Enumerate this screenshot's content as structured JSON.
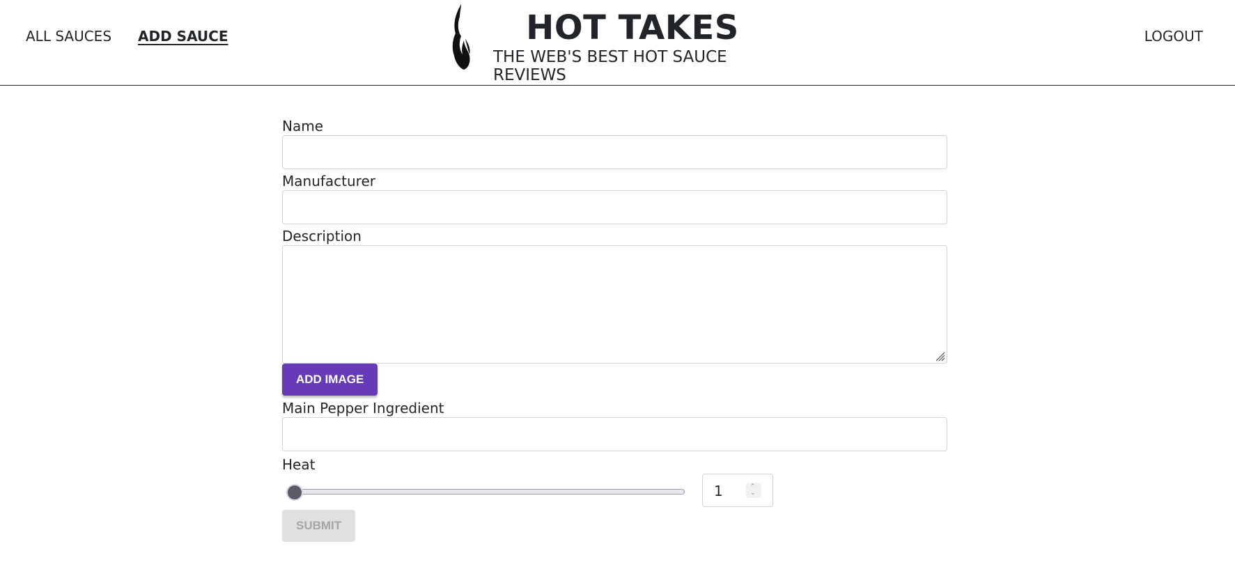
{
  "nav": {
    "all_sauces": "ALL SAUCES",
    "add_sauce": "ADD SAUCE",
    "logout": "LOGOUT"
  },
  "brand": {
    "title": "HOT TAKES",
    "subtitle": "THE WEB'S BEST HOT SAUCE REVIEWS",
    "logo_icon": "flame-icon"
  },
  "form": {
    "name_label": "Name",
    "name_value": "",
    "manufacturer_label": "Manufacturer",
    "manufacturer_value": "",
    "description_label": "Description",
    "description_value": "",
    "add_image_label": "ADD IMAGE",
    "pepper_label": "Main Pepper Ingredient",
    "pepper_value": "",
    "heat_label": "Heat",
    "heat_value": "1",
    "heat_min": 1,
    "heat_max": 10,
    "submit_label": "SUBMIT"
  },
  "colors": {
    "accent": "#673ab7",
    "disabled_bg": "#e0e0e0",
    "disabled_text": "#a5a5a5"
  }
}
